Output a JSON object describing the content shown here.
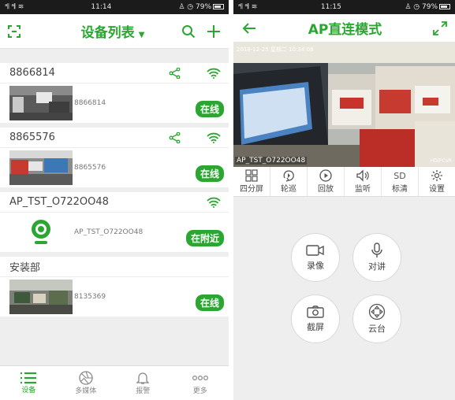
{
  "left": {
    "status": {
      "signal": "ᵃ𝄃 ᵃ𝄃 ≋",
      "time": "11:14",
      "right": "♙ ◷ 79%"
    },
    "header": {
      "title": "设备列表"
    },
    "devices": [
      {
        "name": "8866814",
        "id": "8866814",
        "status": "在线"
      },
      {
        "name": "8865576",
        "id": "8865576",
        "status": "在线"
      },
      {
        "name": "AP_TST_O722OO48",
        "id": "AP_TST_O722OO48",
        "status": "在附近"
      },
      {
        "name": "安装部",
        "id": "8135369",
        "status": "在线"
      }
    ],
    "tabs": [
      {
        "label": "设备",
        "icon": "list-icon"
      },
      {
        "label": "多媒体",
        "icon": "aperture-icon"
      },
      {
        "label": "报警",
        "icon": "bell-icon"
      },
      {
        "label": "更多",
        "icon": "more-icon"
      }
    ]
  },
  "right": {
    "status": {
      "signal": "ᵃ𝄃 ᵃ𝄃 ≋",
      "time": "11:15",
      "right": "♙ ◷ 79%"
    },
    "header": {
      "title": "AP直连模式"
    },
    "video": {
      "timestamp": "2018-12-25 星期二 10:34:08",
      "device_label": "AP_TST_O722OO48",
      "quality_tag": "HD|PCVR"
    },
    "tools": [
      {
        "label": "四分屏",
        "icon": "grid-icon"
      },
      {
        "label": "轮巡",
        "icon": "cycle-icon"
      },
      {
        "label": "回放",
        "icon": "play-icon"
      },
      {
        "label": "监听",
        "icon": "speaker-icon"
      },
      {
        "label": "标清",
        "icon": "sd-icon",
        "glyph": "SD"
      },
      {
        "label": "设置",
        "icon": "gear-icon"
      }
    ],
    "actions": [
      {
        "label": "录像",
        "icon": "video-camera-icon"
      },
      {
        "label": "对讲",
        "icon": "microphone-icon"
      },
      {
        "label": "截屏",
        "icon": "camera-icon"
      },
      {
        "label": "云台",
        "icon": "ptz-icon"
      }
    ]
  },
  "colors": {
    "accent": "#2aa631",
    "status_bar": "#1b1b1b"
  }
}
